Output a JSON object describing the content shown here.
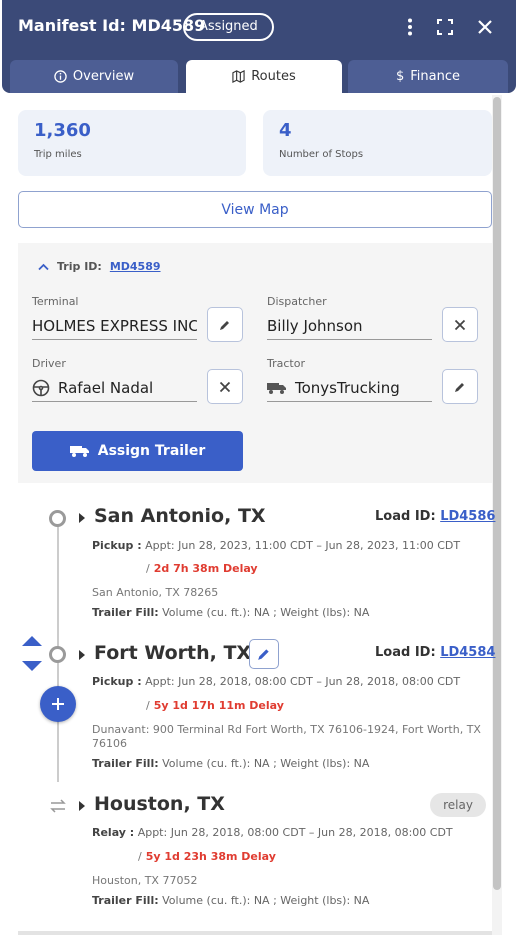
{
  "header": {
    "title": "Manifest Id: MD4589",
    "status_badge": "Assigned",
    "icons": [
      "more-vertical-icon",
      "fullscreen-icon",
      "close-icon"
    ]
  },
  "tabs": [
    {
      "label": "Overview",
      "icon": "info-icon",
      "active": false
    },
    {
      "label": "Routes",
      "icon": "map-icon",
      "active": true
    },
    {
      "label": "Finance",
      "icon": "dollar-icon",
      "active": false
    }
  ],
  "stats": [
    {
      "value": "1,360",
      "label": "Trip miles"
    },
    {
      "value": "4",
      "label": "Number of Stops"
    }
  ],
  "view_map_label": "View Map",
  "trip": {
    "label": "Trip ID:",
    "id": "MD4589",
    "terminal_label": "Terminal",
    "terminal_value": "HOLMES EXPRESS INC",
    "dispatcher_label": "Dispatcher",
    "dispatcher_value": "Billy Johnson",
    "driver_label": "Driver",
    "driver_value": "Rafael Nadal",
    "tractor_label": "Tractor",
    "tractor_value": "TonysTrucking",
    "assign_trailer_label": "Assign Trailer"
  },
  "stops": [
    {
      "city": "San Antonio, TX",
      "load_id_label": "Load ID:",
      "load_id": "LD4586",
      "type_label": "Pickup :",
      "appt": "Appt: Jun 28, 2023, 11:00 CDT  –  Jun 28, 2023, 11:00 CDT",
      "delay": "2d 7h 38m Delay",
      "address": "San Antonio, TX 78265",
      "fill_label": "Trailer Fill:",
      "fill_value": "Volume (cu. ft.):  NA ;  Weight (lbs):  NA"
    },
    {
      "city": "Fort Worth, TX",
      "load_id_label": "Load ID:",
      "load_id": "LD4584",
      "type_label": "Pickup :",
      "appt": "Appt: Jun 28, 2018, 08:00 CDT  –  Jun 28, 2018, 08:00 CDT",
      "delay": "5y 1d 17h 11m Delay",
      "address": "Dunavant: 900 Terminal Rd Fort Worth, TX 76106-1924, Fort Worth, TX 76106",
      "fill_label": "Trailer Fill:",
      "fill_value": "Volume (cu. ft.):  NA ;  Weight (lbs):  NA"
    },
    {
      "city": "Houston, TX",
      "relay_badge": "relay",
      "type_label": "Relay :",
      "appt": "Appt: Jun 28, 2018, 08:00 CDT  –  Jun 28, 2018, 08:00 CDT",
      "delay": "5y 1d 23h 38m Delay",
      "address": "Houston, TX 77052",
      "fill_label": "Trailer Fill:",
      "fill_value": "Volume (cu. ft.):  NA ;  Weight (lbs):  NA"
    }
  ],
  "colors": {
    "header_bg": "#3b4a78",
    "accent": "#3a5fc8",
    "delay": "#e03c31"
  }
}
